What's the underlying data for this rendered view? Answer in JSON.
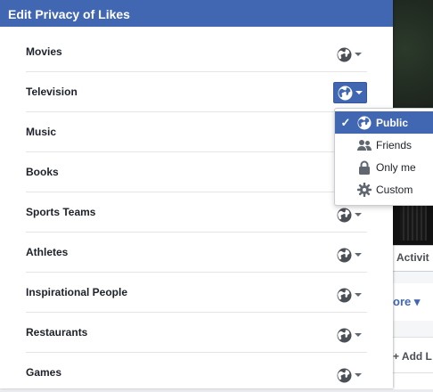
{
  "dialog": {
    "title": "Edit Privacy of Likes",
    "rows": [
      {
        "label": "Movies"
      },
      {
        "label": "Television"
      },
      {
        "label": "Music"
      },
      {
        "label": "Books"
      },
      {
        "label": "Sports Teams"
      },
      {
        "label": "Athletes"
      },
      {
        "label": "Inspirational People"
      },
      {
        "label": "Restaurants"
      },
      {
        "label": "Games"
      }
    ]
  },
  "privacy_menu": {
    "items": [
      {
        "label": "Public",
        "icon": "globe-icon",
        "selected": true
      },
      {
        "label": "Friends",
        "icon": "friends-icon",
        "selected": false
      },
      {
        "label": "Only me",
        "icon": "lock-icon",
        "selected": false
      },
      {
        "label": "Custom",
        "icon": "gear-icon",
        "selected": false
      }
    ]
  },
  "background": {
    "tab_label": "Activit",
    "more_label": "ore ▾",
    "add_label": "+ Add L"
  },
  "colors": {
    "header": "#4267b2",
    "selected": "#4267b2"
  }
}
